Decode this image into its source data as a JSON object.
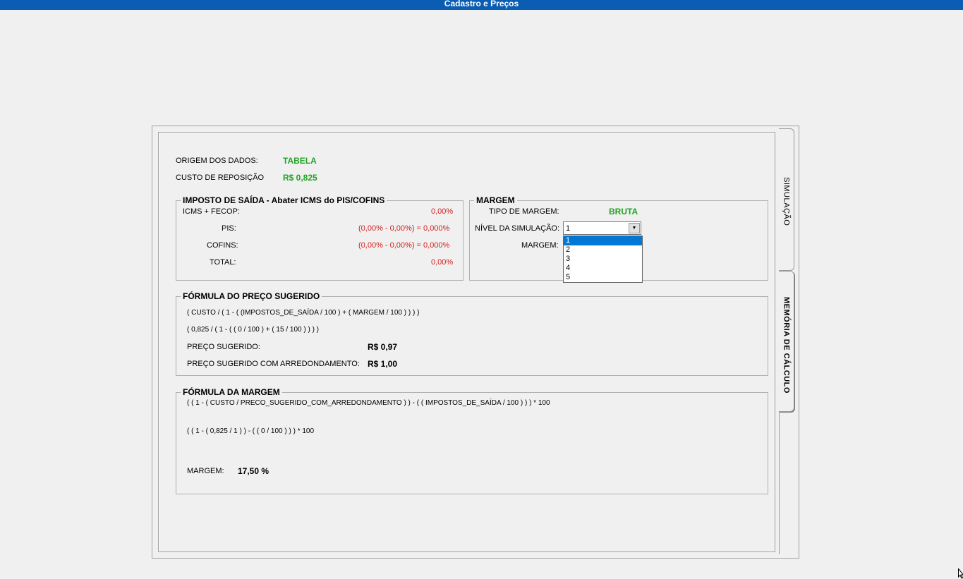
{
  "window": {
    "title": "Cadastro e Preços"
  },
  "origem": {
    "label": "ORIGEM DOS DADOS:",
    "value": "TABELA"
  },
  "custo": {
    "label": "CUSTO DE REPOSIÇÃO",
    "value": "R$ 0,825"
  },
  "imposto": {
    "title": "IMPOSTO DE SAÍDA - Abater ICMS  do PIS/COFINS",
    "icms_label": "ICMS + FECOP:",
    "icms_value": "0,00%",
    "pis_label": "PIS:",
    "pis_value": "(0,00%  -  0,00%)  =  0,000%",
    "cofins_label": "COFINS:",
    "cofins_value": "(0,00%  -  0,00%)  =  0,000%",
    "total_label": "TOTAL:",
    "total_value": "0,00%"
  },
  "margem": {
    "title": "MARGEM",
    "tipo_label": "TIPO DE MARGEM:",
    "tipo_value": "BRUTA",
    "nivel_label": "NÍVEL DA SIMULAÇÃO:",
    "nivel_value": "1",
    "margem_label": "MARGEM:",
    "nivel_options": [
      "1",
      "2",
      "3",
      "4",
      "5"
    ]
  },
  "formula_preco": {
    "title": "FÓRMULA DO PREÇO SUGERIDO",
    "formula": "( CUSTO / ( 1 - ( (IMPOSTOS_DE_SAÍDA / 100 ) + ( MARGEM / 100 ) ) ) )",
    "formula_values": "( 0,825 / ( 1 - ( ( 0 / 100 ) + ( 15 / 100 ) ) ) )",
    "preco_label": "PREÇO SUGERIDO:",
    "preco_value": "R$ 0,97",
    "preco_arred_label": "PREÇO SUGERIDO COM ARREDONDAMENTO:",
    "preco_arred_value": "R$ 1,00"
  },
  "formula_margem": {
    "title": "FÓRMULA DA MARGEM",
    "formula": "( ( 1 - ( CUSTO / PRECO_SUGERIDO_COM_ARREDONDAMENTO ) )  -  ( ( IMPOSTOS_DE_SAÍDA / 100 ) ) ) * 100",
    "formula_values": "( ( 1 - ( 0,825 / 1 ) )  -  ( ( 0 / 100 ) ) ) * 100",
    "margem_label": "MARGEM:",
    "margem_value": "17,50 %"
  },
  "tabs": {
    "simulacao": "SIMULAÇÃO",
    "memoria": "MEMÓRIA DE CÁLCULO"
  }
}
